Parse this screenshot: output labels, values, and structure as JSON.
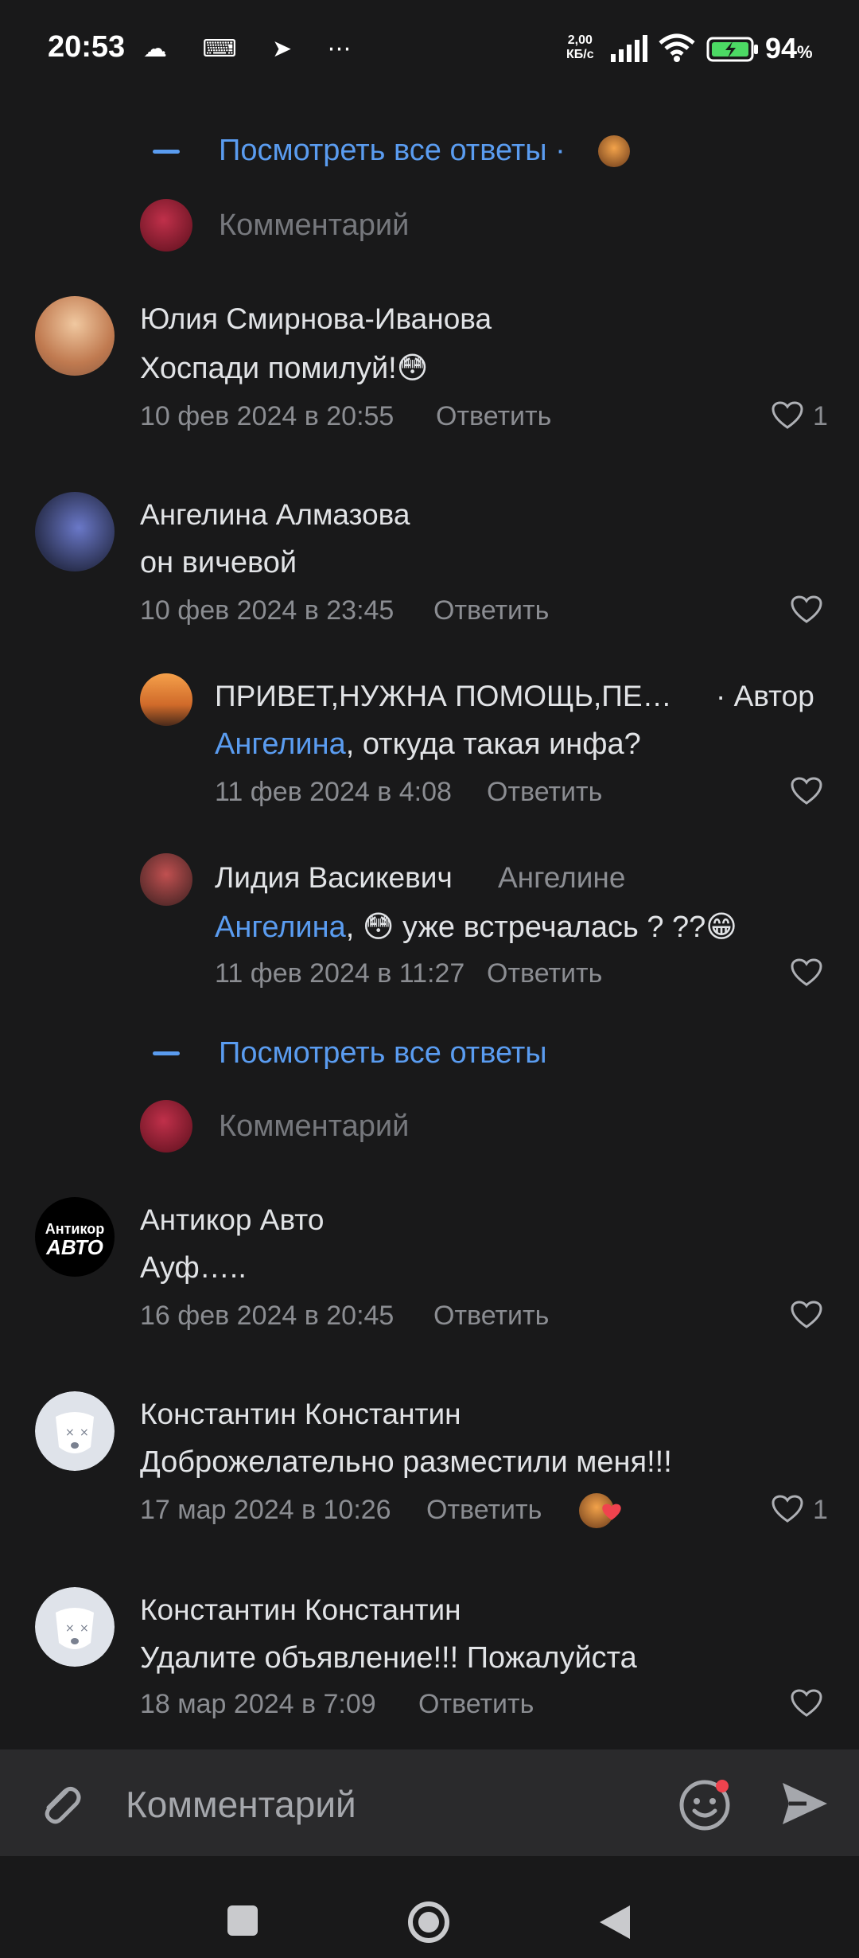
{
  "status": {
    "time": "20:53",
    "icons_left": "☁ ⌨ ➤ ⋯",
    "net_speed": "2,00",
    "net_unit": "КБ/с",
    "battery": "94",
    "battery_unit": "%"
  },
  "thread1": {
    "view_all": "Посмотреть все ответы",
    "view_all_dot": "·",
    "comment_placeholder": "Комментарий"
  },
  "comments": [
    {
      "author": "Юлия Смирнова-Иванова",
      "text": "Хоспади помилуй!😳",
      "date": "10 фев 2024 в 20:55",
      "reply": "Ответить",
      "likes": "1",
      "avatar_color": "#d9a27a"
    },
    {
      "author": "Ангелина Алмазова",
      "text": "он вичевой",
      "date": "10 фев 2024 в 23:45",
      "reply": "Ответить",
      "avatar_color": "#5b6fb5"
    },
    {
      "author": "Антикор Авто",
      "avatar_text": "Антикор",
      "avatar_text2": "АВТО",
      "text": "Ауф…..",
      "date": "16 фев 2024 в 20:45",
      "reply": "Ответить"
    },
    {
      "author": "Константин Константин",
      "text": "Доброжелательно разместили меня!!!",
      "date": "17 мар 2024 в 10:26",
      "reply": "Ответить",
      "likes": "1"
    },
    {
      "author": "Константин Константин",
      "text": "Удалите объявление!!! Пожалуйста",
      "date": "18 мар 2024 в 7:09",
      "reply": "Ответить"
    }
  ],
  "replies": [
    {
      "author": "ПРИВЕТ,НУЖНА ПОМОЩЬ,ПЕ…",
      "badge": "· Автор",
      "mention": "Ангелина",
      "text": ", откуда такая инфа?",
      "date": "11 фев 2024 в 4:08",
      "reply": "Ответить",
      "avatar_color": "#d9833a"
    },
    {
      "author": "Лидия Васикевич",
      "to": "Ангелине",
      "mention": "Ангелина",
      "text": ", 😳 уже встречалась ? ??😁",
      "date": "11 фев 2024 в 11:27",
      "reply": "Ответить",
      "avatar_color": "#8a3b3b"
    }
  ],
  "thread2": {
    "view_all": "Посмотреть все ответы",
    "comment_placeholder": "Комментарий"
  },
  "composer": {
    "placeholder": "Комментарий"
  },
  "colors": {
    "background": "#19191a",
    "accent": "#5a9cf0",
    "muted": "#8b8d92",
    "composer_bg": "#2a2a2c"
  }
}
